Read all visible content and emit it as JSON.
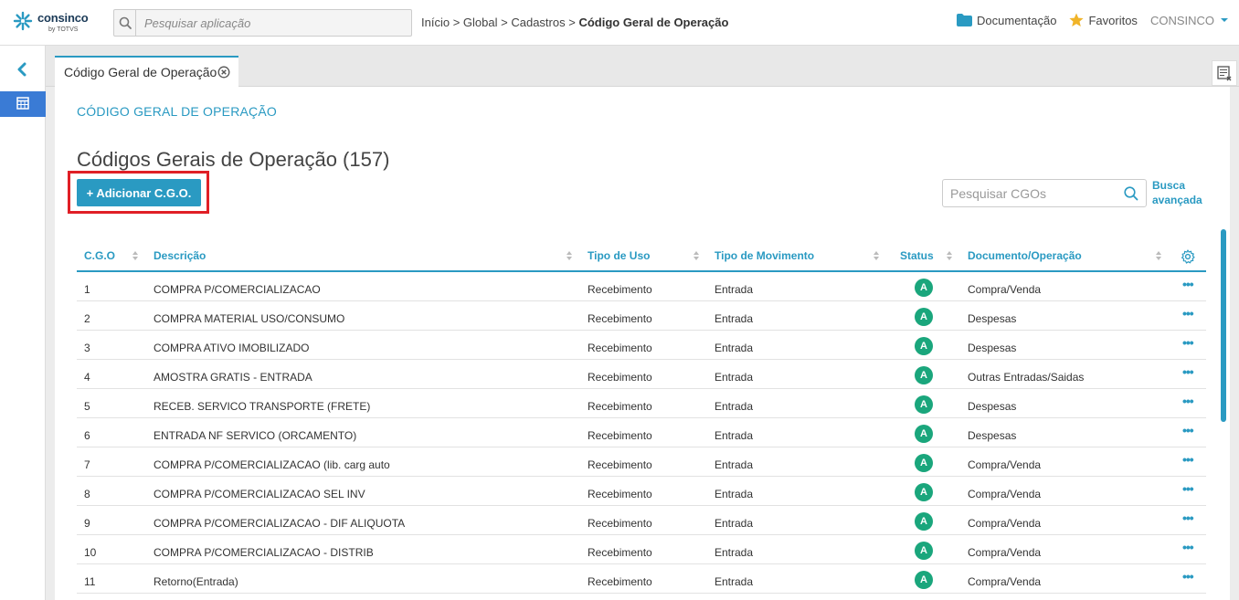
{
  "header": {
    "brand": "consinco",
    "brand_sub": "by TOTVS",
    "search_placeholder": "Pesquisar aplicação",
    "breadcrumb": {
      "items": [
        "Início",
        "Global",
        "Cadastros"
      ],
      "current": "Código Geral de Operação",
      "separator": ">"
    },
    "links": {
      "docs": "Documentação",
      "favorites": "Favoritos",
      "user": "CONSINCO"
    }
  },
  "tabs": [
    {
      "label": "Código Geral de Operação"
    }
  ],
  "main": {
    "section_title": "CÓDIGO GERAL DE OPERAÇÃO",
    "page_title": "Códigos Gerais de Operação (157)",
    "add_button": "+ Adicionar C.G.O.",
    "search_placeholder": "Pesquisar CGOs",
    "advanced_search": [
      "Busca",
      "avançada"
    ]
  },
  "table": {
    "columns": [
      "C.G.O",
      "Descrição",
      "Tipo de Uso",
      "Tipo de Movimento",
      "Status",
      "Documento/Operação"
    ],
    "rows": [
      {
        "cgo": "1",
        "descricao": "COMPRA P/COMERCIALIZACAO",
        "tipo_uso": "Recebimento",
        "tipo_mov": "Entrada",
        "status": "A",
        "doc_op": "Compra/Venda"
      },
      {
        "cgo": "2",
        "descricao": "COMPRA MATERIAL USO/CONSUMO",
        "tipo_uso": "Recebimento",
        "tipo_mov": "Entrada",
        "status": "A",
        "doc_op": "Despesas"
      },
      {
        "cgo": "3",
        "descricao": "COMPRA ATIVO IMOBILIZADO",
        "tipo_uso": "Recebimento",
        "tipo_mov": "Entrada",
        "status": "A",
        "doc_op": "Despesas"
      },
      {
        "cgo": "4",
        "descricao": "AMOSTRA GRATIS - ENTRADA",
        "tipo_uso": "Recebimento",
        "tipo_mov": "Entrada",
        "status": "A",
        "doc_op": "Outras Entradas/Saidas"
      },
      {
        "cgo": "5",
        "descricao": "RECEB. SERVICO TRANSPORTE (FRETE)",
        "tipo_uso": "Recebimento",
        "tipo_mov": "Entrada",
        "status": "A",
        "doc_op": "Despesas"
      },
      {
        "cgo": "6",
        "descricao": "ENTRADA NF SERVICO (ORCAMENTO)",
        "tipo_uso": "Recebimento",
        "tipo_mov": "Entrada",
        "status": "A",
        "doc_op": "Despesas"
      },
      {
        "cgo": "7",
        "descricao": "COMPRA P/COMERCIALIZACAO (lib. carg auto",
        "tipo_uso": "Recebimento",
        "tipo_mov": "Entrada",
        "status": "A",
        "doc_op": "Compra/Venda"
      },
      {
        "cgo": "8",
        "descricao": "COMPRA P/COMERCIALIZACAO SEL INV",
        "tipo_uso": "Recebimento",
        "tipo_mov": "Entrada",
        "status": "A",
        "doc_op": "Compra/Venda"
      },
      {
        "cgo": "9",
        "descricao": "COMPRA P/COMERCIALIZACAO - DIF ALIQUOTA",
        "tipo_uso": "Recebimento",
        "tipo_mov": "Entrada",
        "status": "A",
        "doc_op": "Compra/Venda"
      },
      {
        "cgo": "10",
        "descricao": "COMPRA P/COMERCIALIZACAO - DISTRIB",
        "tipo_uso": "Recebimento",
        "tipo_mov": "Entrada",
        "status": "A",
        "doc_op": "Compra/Venda"
      },
      {
        "cgo": "11",
        "descricao": "Retorno(Entrada)",
        "tipo_uso": "Recebimento",
        "tipo_mov": "Entrada",
        "status": "A",
        "doc_op": "Compra/Venda"
      }
    ]
  },
  "colors": {
    "accent": "#2a9ac2",
    "status_active": "#1aa67c",
    "highlight": "#e01f26",
    "sidebar_active": "#3a7bd5"
  },
  "icons": [
    "search-icon",
    "folder-icon",
    "star-icon",
    "chevron-down-icon",
    "chevron-left-icon",
    "calendar-icon",
    "close-circle-icon",
    "gear-icon",
    "more-icon",
    "sort-icon"
  ]
}
